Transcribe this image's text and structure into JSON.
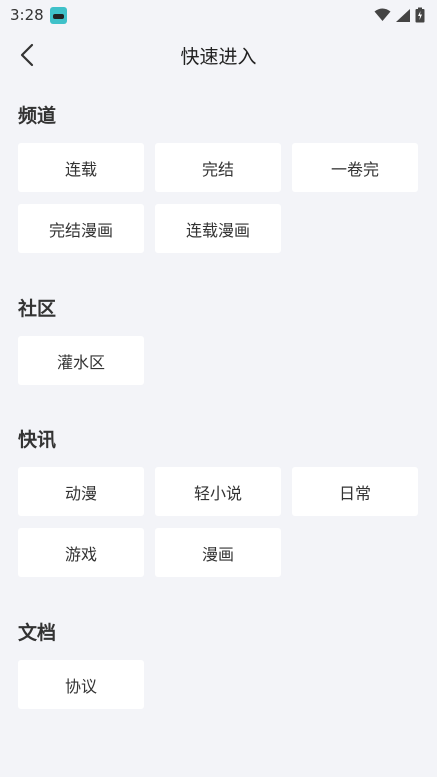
{
  "status_bar": {
    "time": "3:28"
  },
  "nav": {
    "title": "快速进入"
  },
  "sections": [
    {
      "title": "频道",
      "items": [
        "连载",
        "完结",
        "一卷完",
        "完结漫画",
        "连载漫画"
      ]
    },
    {
      "title": "社区",
      "items": [
        "灌水区"
      ]
    },
    {
      "title": "快讯",
      "items": [
        "动漫",
        "轻小说",
        "日常",
        "游戏",
        "漫画"
      ]
    },
    {
      "title": "文档",
      "items": [
        "协议"
      ]
    }
  ]
}
